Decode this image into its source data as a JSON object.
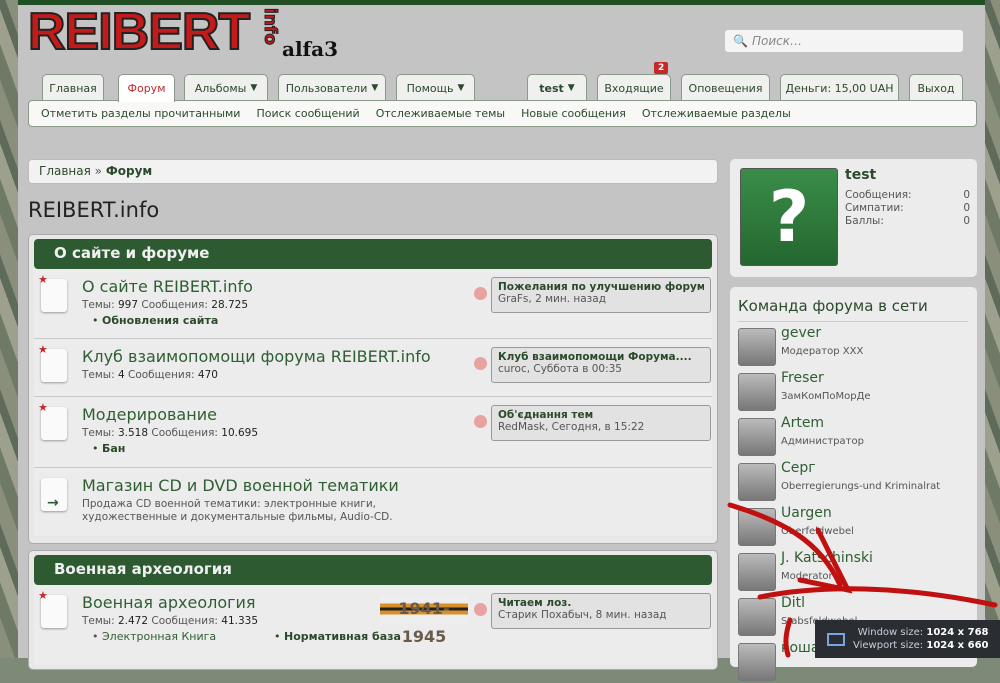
{
  "header": {
    "logo": "REIBERT",
    "logo_suffix": "info",
    "subtitle": "alfa3",
    "search_placeholder": "Поиск…"
  },
  "nav": {
    "tabs": [
      {
        "label": "Главная"
      },
      {
        "label": "Форум",
        "active": true
      },
      {
        "label": "Альбомы"
      },
      {
        "label": "Пользователи"
      },
      {
        "label": "Помощь"
      }
    ],
    "user_tabs": [
      {
        "label": "test"
      },
      {
        "label": "Входящие",
        "badge": "2"
      },
      {
        "label": "Оповещения"
      },
      {
        "label": "Деньги: 15,00 UAH"
      },
      {
        "label": "Выход"
      }
    ],
    "subnav": [
      "Отметить разделы прочитанными",
      "Поиск сообщений",
      "Отслеживаемые темы",
      "Новые сообщения",
      "Отслеживаемые разделы"
    ]
  },
  "breadcrumb": [
    "Главная",
    "Форум"
  ],
  "page_title": "REIBERT.info",
  "categories": [
    {
      "title": "О сайте и форуме",
      "forums": [
        {
          "name": "О сайте REIBERT.info",
          "threads": "997",
          "posts": "28.725",
          "sub": [
            "Обновления сайта"
          ],
          "last_title": "Пожелания по улучшению форума",
          "last_meta": "GraFs, 2 мин. назад"
        },
        {
          "name": "Клуб взаимопомощи форума REIBERT.info",
          "threads": "4",
          "posts": "470",
          "last_title": "Клуб взаимопомощи Форума....",
          "last_meta": "curoc, Суббота в 00:35"
        },
        {
          "name": "Модерирование",
          "threads": "3.518",
          "posts": "10.695",
          "sub": [
            "Бан"
          ],
          "last_title": "Об'єднання тем",
          "last_meta": "RedMask, Сегодня, в 15:22"
        },
        {
          "name": "Магазин CD и DVD военной тематики",
          "desc": "Продажа CD военной тематики: электронные книги, художественные и документальные фильмы, Audio-CD."
        }
      ]
    },
    {
      "title": "Военная археология",
      "forums": [
        {
          "name": "Военная археология",
          "threads": "2.472",
          "posts": "41.335",
          "sub": [
            "Электронная Книга",
            "Нормативная база"
          ],
          "banner": "1941-1945",
          "last_title": "Читаем лоз.",
          "last_meta": "Старик Похабыч, 8 мин. назад"
        }
      ]
    }
  ],
  "labels": {
    "threads": "Темы:",
    "posts": "Сообщения:"
  },
  "profile": {
    "name": "test",
    "stats": [
      {
        "label": "Сообщения:",
        "value": "0"
      },
      {
        "label": "Симпатии:",
        "value": "0"
      },
      {
        "label": "Баллы:",
        "value": "0"
      }
    ]
  },
  "staff": {
    "title": "Команда форума в сети",
    "members": [
      {
        "name": "gever",
        "role": "Модератор XXX"
      },
      {
        "name": "Freser",
        "role": "ЗамКомПоМорДе"
      },
      {
        "name": "Artem",
        "role": "Администратор"
      },
      {
        "name": "Серг",
        "role": "Oberregierungs-und Kriminalrat"
      },
      {
        "name": "Uargen",
        "role": "Oberfeldwebel"
      },
      {
        "name": "J. Katschinski",
        "role": "Moderator"
      },
      {
        "name": "Ditl",
        "role": "Stabsfeldwebel"
      },
      {
        "name": "кошак",
        "role": ""
      }
    ]
  },
  "overlay": {
    "window_label": "Window size:",
    "window_value": "1024 x 768",
    "viewport_label": "Viewport size:",
    "viewport_value": "1024 x 660"
  },
  "colors": {
    "accent": "#2e5a31",
    "active_tab": "#c62828",
    "annotation": "#c01010"
  }
}
